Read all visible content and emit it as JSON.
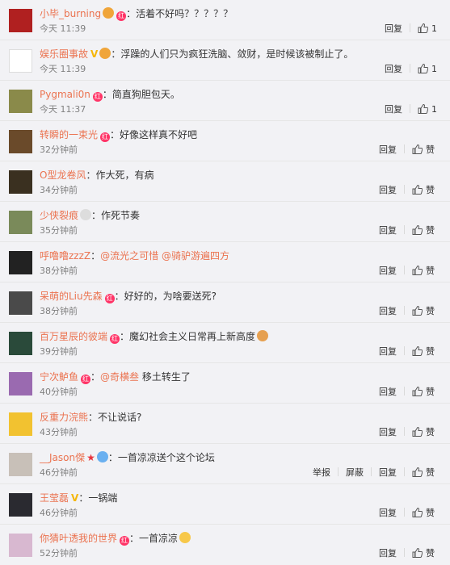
{
  "reply_label": "回复",
  "like_label": "赞",
  "report_label": "举报",
  "block_label": "屏蔽",
  "colors": {
    "username": "#eb7350",
    "time": "#808080",
    "background": "#f2f2f5"
  },
  "comments": [
    {
      "username": "小毕_burning",
      "text": "活着不好吗？？？？？",
      "time": "今天 11:39",
      "likes": "1"
    },
    {
      "username": "娱乐圈事故",
      "text": "浮躁的人们只为疯狂洗脑、敛财，是时候该被制止了。",
      "time": "今天 11:39",
      "likes": "1"
    },
    {
      "username": "Pygmali0n",
      "text": "简直狗胆包天。",
      "time": "今天 11:37",
      "likes": "1"
    },
    {
      "username": "转瞬的一束光",
      "text": "好像这样真不好吧",
      "time": "32分钟前",
      "likes": ""
    },
    {
      "username": "O型龙卷风",
      "text": "作大死，有病",
      "time": "34分钟前",
      "likes": ""
    },
    {
      "username": "少侠裂痕",
      "text": "作死节奏",
      "time": "35分钟前",
      "likes": ""
    },
    {
      "username": "呼噜噜zzzZ",
      "text": "",
      "mention1": "@流光之可惜",
      "mention2": "@骑驴游遍四方",
      "time": "38分钟前",
      "likes": ""
    },
    {
      "username": "呆萌的Liu先森",
      "text": "好好的，为啥要送死?",
      "time": "38分钟前",
      "likes": ""
    },
    {
      "username": "百万星辰的彼端",
      "text": "魔幻社会主义日常再上新高度",
      "time": "39分钟前",
      "likes": ""
    },
    {
      "username": "宁次鲈鱼",
      "text": "移土转生了",
      "mention1": "@奇横叁",
      "time": "40分钟前",
      "likes": ""
    },
    {
      "username": "反重力浣熊",
      "text": "不让说话?",
      "time": "43分钟前",
      "likes": ""
    },
    {
      "username": "__Jason傑",
      "text": "一首凉凉送个这个论坛",
      "time": "46分钟前",
      "likes": ""
    },
    {
      "username": "王莹磊",
      "text": "一锅端",
      "time": "46分钟前",
      "likes": ""
    },
    {
      "username": "你猜叶透我的世界",
      "text": "一首凉凉",
      "time": "52分钟前",
      "likes": ""
    }
  ]
}
